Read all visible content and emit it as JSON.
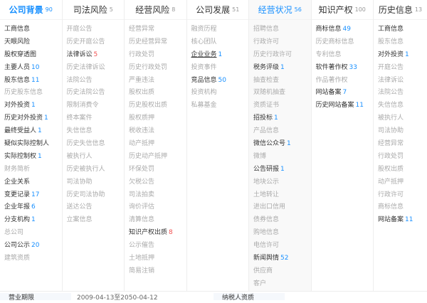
{
  "columns": [
    {
      "title": "公司背景",
      "count": "90",
      "active": true,
      "items": [
        {
          "label": "工商信息",
          "count": "",
          "on": true
        },
        {
          "label": "天眼风险",
          "count": "",
          "on": true
        },
        {
          "label": "股权穿透图",
          "count": "",
          "on": true
        },
        {
          "label": "主要人员",
          "count": "10",
          "on": true
        },
        {
          "label": "股东信息",
          "count": "11",
          "on": true
        },
        {
          "label": "历史股东信息",
          "count": "",
          "on": false
        },
        {
          "label": "对外投资",
          "count": "1",
          "on": true
        },
        {
          "label": "历史对外投资",
          "count": "1",
          "on": true
        },
        {
          "label": "最终受益人",
          "count": "1",
          "on": true
        },
        {
          "label": "疑似实际控制人",
          "count": "",
          "on": true
        },
        {
          "label": "实际控制权",
          "count": "1",
          "on": true
        },
        {
          "label": "财务简析",
          "count": "",
          "on": false
        },
        {
          "label": "企业关系",
          "count": "",
          "on": true
        },
        {
          "label": "变更记录",
          "count": "17",
          "on": true
        },
        {
          "label": "企业年报",
          "count": "6",
          "on": true
        },
        {
          "label": "分支机构",
          "count": "1",
          "on": true
        },
        {
          "label": "总公司",
          "count": "",
          "on": false
        },
        {
          "label": "公司公示",
          "count": "20",
          "on": true
        },
        {
          "label": "建筑资质",
          "count": "",
          "on": false
        }
      ]
    },
    {
      "title": "司法风险",
      "count": "5",
      "items": [
        {
          "label": "开庭公告",
          "count": "",
          "on": false
        },
        {
          "label": "历史开庭公告",
          "count": "",
          "on": false
        },
        {
          "label": "法律诉讼",
          "count": "5",
          "on": true,
          "red": true
        },
        {
          "label": "历史法律诉讼",
          "count": "",
          "on": false
        },
        {
          "label": "法院公告",
          "count": "",
          "on": false
        },
        {
          "label": "历史法院公告",
          "count": "",
          "on": false
        },
        {
          "label": "限制消费令",
          "count": "",
          "on": false
        },
        {
          "label": "终本案件",
          "count": "",
          "on": false
        },
        {
          "label": "失信信息",
          "count": "",
          "on": false
        },
        {
          "label": "历史失信信息",
          "count": "",
          "on": false
        },
        {
          "label": "被执行人",
          "count": "",
          "on": false
        },
        {
          "label": "历史被执行人",
          "count": "",
          "on": false
        },
        {
          "label": "司法协助",
          "count": "",
          "on": false
        },
        {
          "label": "历史司法协助",
          "count": "",
          "on": false
        },
        {
          "label": "送达公告",
          "count": "",
          "on": false
        },
        {
          "label": "立案信息",
          "count": "",
          "on": false
        }
      ]
    },
    {
      "title": "经营风险",
      "count": "8",
      "items": [
        {
          "label": "经营异常",
          "count": "",
          "on": false
        },
        {
          "label": "历史经营异常",
          "count": "",
          "on": false
        },
        {
          "label": "行政处罚",
          "count": "",
          "on": false
        },
        {
          "label": "历史行政处罚",
          "count": "",
          "on": false
        },
        {
          "label": "严重违法",
          "count": "",
          "on": false
        },
        {
          "label": "股权出质",
          "count": "",
          "on": false
        },
        {
          "label": "历史股权出质",
          "count": "",
          "on": false
        },
        {
          "label": "股权质押",
          "count": "",
          "on": false
        },
        {
          "label": "税收违法",
          "count": "",
          "on": false
        },
        {
          "label": "动产抵押",
          "count": "",
          "on": false
        },
        {
          "label": "历史动产抵押",
          "count": "",
          "on": false
        },
        {
          "label": "环保处罚",
          "count": "",
          "on": false
        },
        {
          "label": "欠税公告",
          "count": "",
          "on": false
        },
        {
          "label": "司法拍卖",
          "count": "",
          "on": false
        },
        {
          "label": "询价评估",
          "count": "",
          "on": false
        },
        {
          "label": "清算信息",
          "count": "",
          "on": false
        },
        {
          "label": "知识产权出质",
          "count": "8",
          "on": true,
          "red": true
        },
        {
          "label": "公示催告",
          "count": "",
          "on": false
        },
        {
          "label": "土地抵押",
          "count": "",
          "on": false
        },
        {
          "label": "简易注销",
          "count": "",
          "on": false
        }
      ]
    },
    {
      "title": "公司发展",
      "count": "51",
      "items": [
        {
          "label": "融资历程",
          "count": "",
          "on": false
        },
        {
          "label": "核心团队",
          "count": "",
          "on": false
        },
        {
          "label": "企业业务",
          "count": "1",
          "on": true,
          "ul": true
        },
        {
          "label": "投资事件",
          "count": "",
          "on": false
        },
        {
          "label": "竞品信息",
          "count": "50",
          "on": true
        },
        {
          "label": "投资机构",
          "count": "",
          "on": false
        },
        {
          "label": "私募基金",
          "count": "",
          "on": false
        }
      ]
    },
    {
      "title": "经营状况",
      "count": "56",
      "blue": true,
      "shade": true,
      "items": [
        {
          "label": "招聘信息",
          "count": "",
          "on": false
        },
        {
          "label": "行政许可",
          "count": "",
          "on": false
        },
        {
          "label": "历史行政许可",
          "count": "",
          "on": false
        },
        {
          "label": "税务评级",
          "count": "1",
          "on": true
        },
        {
          "label": "抽查检查",
          "count": "",
          "on": false
        },
        {
          "label": "双随机抽查",
          "count": "",
          "on": false
        },
        {
          "label": "资质证书",
          "count": "",
          "on": false
        },
        {
          "label": "招投标",
          "count": "1",
          "on": true
        },
        {
          "label": "产品信息",
          "count": "",
          "on": false
        },
        {
          "label": "微信公众号",
          "count": "1",
          "on": true
        },
        {
          "label": "微博",
          "count": "",
          "on": false
        },
        {
          "label": "公告研报",
          "count": "1",
          "on": true
        },
        {
          "label": "地块公示",
          "count": "",
          "on": false
        },
        {
          "label": "土地转让",
          "count": "",
          "on": false
        },
        {
          "label": "进出口信用",
          "count": "",
          "on": false
        },
        {
          "label": "债券信息",
          "count": "",
          "on": false
        },
        {
          "label": "购地信息",
          "count": "",
          "on": false
        },
        {
          "label": "电信许可",
          "count": "",
          "on": false
        },
        {
          "label": "新闻舆情",
          "count": "52",
          "on": true
        },
        {
          "label": "供应商",
          "count": "",
          "on": false
        },
        {
          "label": "客户",
          "count": "",
          "on": false
        }
      ]
    },
    {
      "title": "知识产权",
      "count": "100",
      "items": [
        {
          "label": "商标信息",
          "count": "49",
          "on": true
        },
        {
          "label": "历史商标信息",
          "count": "",
          "on": false
        },
        {
          "label": "专利信息",
          "count": "",
          "on": false
        },
        {
          "label": "软件著作权",
          "count": "33",
          "on": true
        },
        {
          "label": "作品著作权",
          "count": "",
          "on": false
        },
        {
          "label": "网站备案",
          "count": "7",
          "on": true
        },
        {
          "label": "历史网站备案",
          "count": "11",
          "on": true
        }
      ]
    },
    {
      "title": "历史信息",
      "count": "13",
      "items": [
        {
          "label": "工商信息",
          "count": "",
          "on": true
        },
        {
          "label": "股东信息",
          "count": "",
          "on": false
        },
        {
          "label": "对外投资",
          "count": "1",
          "on": true
        },
        {
          "label": "开庭公告",
          "count": "",
          "on": false
        },
        {
          "label": "法律诉讼",
          "count": "",
          "on": false
        },
        {
          "label": "法院公告",
          "count": "",
          "on": false
        },
        {
          "label": "失信信息",
          "count": "",
          "on": false
        },
        {
          "label": "被执行人",
          "count": "",
          "on": false
        },
        {
          "label": "司法协助",
          "count": "",
          "on": false
        },
        {
          "label": "经营异常",
          "count": "",
          "on": false
        },
        {
          "label": "行政处罚",
          "count": "",
          "on": false
        },
        {
          "label": "股权出质",
          "count": "",
          "on": false
        },
        {
          "label": "动产抵押",
          "count": "",
          "on": false
        },
        {
          "label": "行政许可",
          "count": "",
          "on": false
        },
        {
          "label": "商标信息",
          "count": "",
          "on": false
        },
        {
          "label": "网站备案",
          "count": "11",
          "on": true
        }
      ]
    }
  ],
  "footer": {
    "term_label": "营业期限",
    "term_value": "2009-04-13至2050-04-12",
    "taxpayer_label": "纳税人资质"
  }
}
